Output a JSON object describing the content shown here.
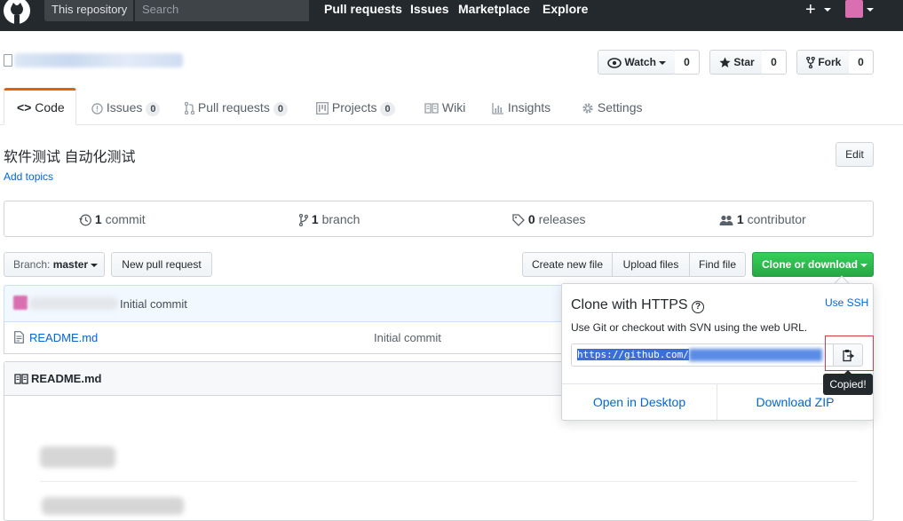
{
  "header": {
    "scope_label": "This repository",
    "search_placeholder": "Search",
    "nav": [
      "Pull requests",
      "Issues",
      "Marketplace",
      "Explore"
    ],
    "plus": "+"
  },
  "repo_actions": {
    "watch_label": "Watch",
    "watch_count": "0",
    "star_label": "Star",
    "star_count": "0",
    "fork_label": "Fork",
    "fork_count": "0"
  },
  "tabs": [
    {
      "label": "Code"
    },
    {
      "label": "Issues",
      "count": "0"
    },
    {
      "label": "Pull requests",
      "count": "0"
    },
    {
      "label": "Projects",
      "count": "0"
    },
    {
      "label": "Wiki"
    },
    {
      "label": "Insights"
    },
    {
      "label": "Settings"
    }
  ],
  "description": "软件测试 自动化测试",
  "edit_label": "Edit",
  "add_topics": "Add topics",
  "summary": {
    "commits_num": "1",
    "commits_label": "commit",
    "branches_num": "1",
    "branches_label": "branch",
    "releases_num": "0",
    "releases_label": "releases",
    "contributors_num": "1",
    "contributors_label": "contributor"
  },
  "file_nav": {
    "branch_prefix": "Branch:",
    "branch_name": "master",
    "new_pr": "New pull request",
    "create_file": "Create new file",
    "upload_files": "Upload files",
    "find_file": "Find file",
    "clone_download": "Clone or download"
  },
  "commit_bar": {
    "message": "Initial commit"
  },
  "files": [
    {
      "name": "README.md",
      "message": "Initial commit"
    }
  ],
  "readme_title": "README.md",
  "clone_popover": {
    "title": "Clone with HTTPS",
    "help_glyph": "?",
    "use_ssh": "Use SSH",
    "desc": "Use Git or checkout with SVN using the web URL.",
    "url_prefix": "https://github.com/",
    "open_desktop": "Open in Desktop",
    "download_zip": "Download ZIP",
    "tooltip": "Copied!"
  },
  "colors": {
    "header_bg": "#24292e",
    "link": "#0366d6",
    "green": "#28a745",
    "tab_accent": "#e36209"
  }
}
